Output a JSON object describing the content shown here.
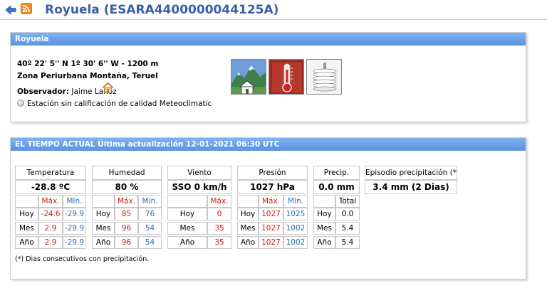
{
  "header": {
    "title": "Royuela (ESARA4400000044125A)",
    "back_icon": "arrow-left-icon",
    "rss_icon": "rss-feed-icon"
  },
  "station_panel": {
    "title": "Royuela",
    "coordinates": "40º 22' 5'' N   1º 30' 6'' W  -  1200 m",
    "zone": "Zona Periurbana Montaña, Teruel",
    "observer_label": "Observador:",
    "observer_name": "Jaime Lahoz",
    "quality": "Estación sin calificación de calidad Meteoclimatic",
    "images": [
      "mountain-house-image",
      "thermometer-image",
      "radiation-shield-image"
    ]
  },
  "weather_panel": {
    "title": "EL TIEMPO ACTUAL Última actualización 12-01-2021 06:30 UTC",
    "row_labels": [
      "Hoy",
      "Mes",
      "Año"
    ],
    "max_label": "Máx.",
    "min_label": "Mín.",
    "total_label": "Total",
    "temperature": {
      "label": "Temperatura",
      "current": "-28.8 ºC",
      "max": [
        "-24.6",
        "2.9",
        "2.9"
      ],
      "min": [
        "-29.9",
        "-29.9",
        "-29.9"
      ]
    },
    "humidity": {
      "label": "Humedad",
      "current": "80 %",
      "max": [
        "85",
        "96",
        "96"
      ],
      "min": [
        "76",
        "54",
        "54"
      ]
    },
    "wind": {
      "label": "Viento",
      "current": "SSO  0 km/h",
      "max": [
        "0",
        "35",
        "35"
      ]
    },
    "pressure": {
      "label": "Presión",
      "current": "1027 hPa",
      "max": [
        "1027",
        "1027",
        "1027"
      ],
      "min": [
        "1025",
        "1002",
        "1002"
      ]
    },
    "precip": {
      "label": "Precip.",
      "current": "0.0 mm",
      "total": [
        "0.0",
        "5.4",
        "5.4"
      ]
    },
    "episode": {
      "label": "Episodio precipitación (*)",
      "value": "3.4 mm (2 Dias)"
    },
    "footnote": "(*) Dias consecutivos con precipitación."
  },
  "colors": {
    "title": "#3a5fa6",
    "panel_header": "#5b93e0",
    "max": "#d81818",
    "min": "#2a6db3"
  }
}
